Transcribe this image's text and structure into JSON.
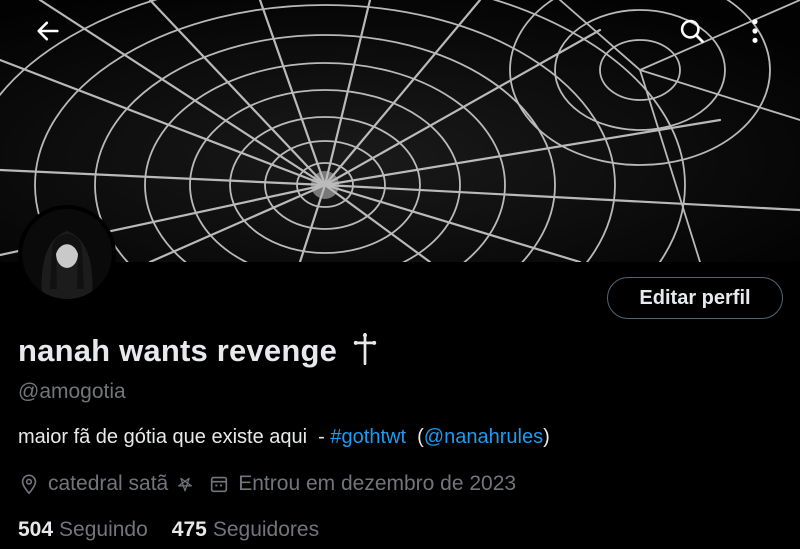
{
  "header": {
    "back_icon": "arrow-left-icon",
    "search_icon": "search-icon",
    "more_icon": "more-vertical-icon"
  },
  "profile": {
    "display_name": "nanah wants revenge",
    "name_symbol": "cross-icon",
    "handle": "@amogotia",
    "edit_label": "Editar perfil",
    "bio": {
      "text": "maior fã de gótia que existe aqui  - ",
      "hashtag": "#gothtwt",
      "mention_open": "  (",
      "mention": "@nanahrules",
      "mention_close": ")"
    },
    "location": "catedral satã",
    "location_icon": "location-pin-icon",
    "location_symbol": "pentagram-icon",
    "joined": "Entrou em dezembro de 2023",
    "joined_icon": "calendar-icon",
    "following_count": "504",
    "following_label": "Seguindo",
    "followers_count": "475",
    "followers_label": "Seguidores"
  },
  "colors": {
    "background": "#000000",
    "text": "#e7e9ea",
    "muted": "#71767b",
    "link": "#1d9bf0",
    "border": "#536471"
  }
}
